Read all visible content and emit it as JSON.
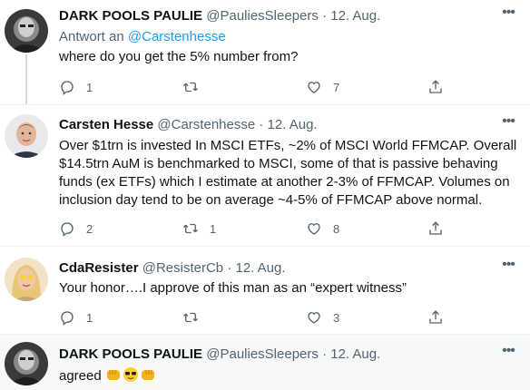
{
  "tweets": [
    {
      "name": "DARK POOLS PAULIE",
      "handle": "@PauliesSleepers",
      "separator": "·",
      "date": "12. Aug.",
      "reply_prefix": "Antwort an",
      "reply_mention": "@Carstenhesse",
      "text": "where do you get the 5% number from?",
      "replies": "1",
      "retweets": "",
      "likes": "7"
    },
    {
      "name": "Carsten Hesse",
      "handle": "@Carstenhesse",
      "separator": "·",
      "date": "12. Aug.",
      "text": "Over $1trn is invested In MSCI ETFs, ~2% of MSCI World FFMCAP. Overall $14.5trn AuM is benchmarked to MSCI, some of that is passive behaving funds (ex ETFs) which I estimate at another 2-3% of FFMCAP. Volumes on inclusion day tend to be on average ~4-5% of FFMCAP above normal.",
      "replies": "2",
      "retweets": "1",
      "likes": "8"
    },
    {
      "name": "CdaResister",
      "handle": "@ResisterCb",
      "separator": "·",
      "date": "12. Aug.",
      "text": "Your honor….I approve of this man as an “expert witness”",
      "replies": "1",
      "retweets": "",
      "likes": "3"
    },
    {
      "name": "DARK POOLS PAULIE",
      "handle": "@PauliesSleepers",
      "separator": "·",
      "date": "12. Aug.",
      "text": "agreed",
      "emojis": [
        "fist-bump-emoji",
        "sunglasses-emoji",
        "fist-bump-emoji"
      ]
    }
  ],
  "colors": {
    "accent": "#1d9bf0",
    "secondary_text": "#536471",
    "primary_text": "#0f1419",
    "highlight_bg": "#f7f9f9"
  },
  "icons": [
    "reply-icon",
    "retweet-icon",
    "like-icon",
    "share-icon",
    "more-icon"
  ]
}
